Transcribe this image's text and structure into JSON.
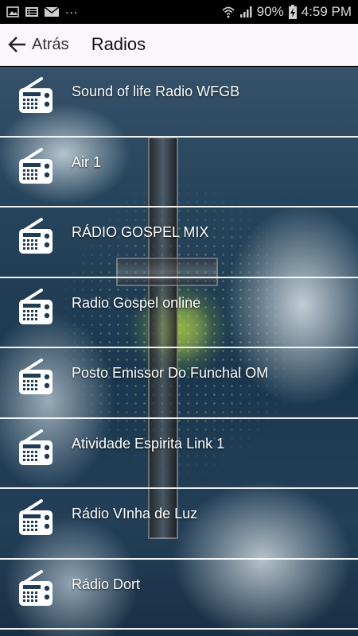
{
  "status_bar": {
    "dots": "...",
    "battery_percent": "90%",
    "time": "4:59 PM"
  },
  "app_bar": {
    "back_label": "Atrás",
    "title": "Radios"
  },
  "colors": {
    "app_bar_bg": "#faf6fb",
    "list_text": "#ffffff",
    "divider": "#ffffff"
  },
  "radios": [
    {
      "name": "Sound of life Radio WFGB",
      "icon": "radio-icon"
    },
    {
      "name": "Air 1",
      "icon": "radio-icon"
    },
    {
      "name": "RÁDIO GOSPEL MIX",
      "icon": "radio-icon"
    },
    {
      "name": "Radio Gospel online",
      "icon": "radio-icon"
    },
    {
      "name": "Posto Emissor Do Funchal OM",
      "icon": "radio-icon"
    },
    {
      "name": "Atividade Espirita Link 1",
      "icon": "radio-icon"
    },
    {
      "name": "Rádio VInha de Luz",
      "icon": "radio-icon"
    },
    {
      "name": "Rádio Dort",
      "icon": "radio-icon"
    }
  ]
}
